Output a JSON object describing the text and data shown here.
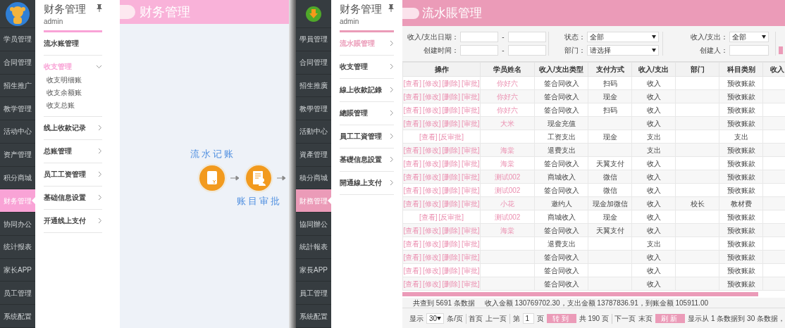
{
  "left_screen": {
    "sidebar": {
      "items": [
        {
          "label": "学员管理",
          "selected": false
        },
        {
          "label": "合同管理",
          "selected": false
        },
        {
          "label": "招生推广",
          "selected": false
        },
        {
          "label": "教学管理",
          "selected": false
        },
        {
          "label": "活动中心",
          "selected": false
        },
        {
          "label": "资产管理",
          "selected": false
        },
        {
          "label": "积分商城",
          "selected": false
        },
        {
          "label": "财务管理",
          "selected": true
        },
        {
          "label": "协同办公",
          "selected": false
        },
        {
          "label": "统计报表",
          "selected": false
        },
        {
          "label": "家长APP",
          "selected": false
        },
        {
          "label": "员工管理",
          "selected": false
        },
        {
          "label": "系统配置",
          "selected": false
        }
      ]
    },
    "menu": {
      "title": "财务管理",
      "user": "admin",
      "items": [
        {
          "label": "流水账管理",
          "kind": "link",
          "selected": false
        },
        {
          "label": "收支管理",
          "kind": "group",
          "selected": true,
          "expanded": true,
          "children": [
            {
              "label": "收支明细账"
            },
            {
              "label": "收支余额账"
            },
            {
              "label": "收支总账"
            }
          ]
        },
        {
          "label": "线上收款记录",
          "kind": "group",
          "selected": false,
          "expanded": false
        },
        {
          "label": "总账管理",
          "kind": "group",
          "selected": false,
          "expanded": false
        },
        {
          "label": "员工工资管理",
          "kind": "group",
          "selected": false,
          "expanded": false
        },
        {
          "label": "基础信息设置",
          "kind": "group",
          "selected": false,
          "expanded": false
        },
        {
          "label": "开通线上支付",
          "kind": "group",
          "selected": false,
          "expanded": false
        }
      ]
    },
    "page_header": {
      "title": "财务管理"
    },
    "flow": {
      "top_labels": [
        "流水记账"
      ],
      "bottom_labels": [
        "账目审批"
      ]
    }
  },
  "right_screen": {
    "sidebar": {
      "items": [
        {
          "label": "學員管理",
          "selected": false
        },
        {
          "label": "合同管理",
          "selected": false
        },
        {
          "label": "招生推廣",
          "selected": false
        },
        {
          "label": "教學管理",
          "selected": false
        },
        {
          "label": "活動中心",
          "selected": false
        },
        {
          "label": "資產管理",
          "selected": false
        },
        {
          "label": "積分商城",
          "selected": false
        },
        {
          "label": "財務管理",
          "selected": true
        },
        {
          "label": "協同辦公",
          "selected": false
        },
        {
          "label": "統計報表",
          "selected": false
        },
        {
          "label": "家長APP",
          "selected": false
        },
        {
          "label": "員工管理",
          "selected": false
        },
        {
          "label": "系統配置",
          "selected": false
        }
      ]
    },
    "menu": {
      "title": "财务管理",
      "user": "admin",
      "items": [
        {
          "label": "流水賬管理",
          "kind": "group",
          "selected": true,
          "expanded": false
        },
        {
          "label": "收支管理",
          "kind": "group",
          "selected": false,
          "expanded": false
        },
        {
          "label": "線上收款記錄",
          "kind": "group",
          "selected": false,
          "expanded": false
        },
        {
          "label": "總賬管理",
          "kind": "group",
          "selected": false,
          "expanded": false
        },
        {
          "label": "員工工資管理",
          "kind": "group",
          "selected": false,
          "expanded": false
        },
        {
          "label": "基礎信息設置",
          "kind": "group",
          "selected": false,
          "expanded": false
        },
        {
          "label": "開通線上支付",
          "kind": "group",
          "selected": false,
          "expanded": false
        }
      ]
    },
    "page_header": {
      "title": "流水賬管理"
    },
    "filters": {
      "date_label": "收入/支出日期：",
      "created_label": "创建时间：",
      "range_separators": [
        "-",
        "-"
      ],
      "status_label": "状态：",
      "status_value": "全部",
      "department_label": "部门：",
      "department_value": "请选择",
      "direction_label": "收入/支出：",
      "direction_value": "全部",
      "creator_label": "创建人："
    },
    "table": {
      "columns": [
        "操作",
        "学员姓名",
        "收入/支出类型",
        "支付方式",
        "收入/支出",
        "部门",
        "科目类别",
        "收入"
      ],
      "rows": [
        {
          "actions": [
            "[查看]",
            "[修改]",
            "[删除]",
            "[审批]"
          ],
          "student": "你好六",
          "type": "签合同收入",
          "payment": "扫码",
          "direction": "收入",
          "category": "预收账款"
        },
        {
          "actions": [
            "[查看]",
            "[修改]",
            "[删除]",
            "[审批]"
          ],
          "student": "你好六",
          "type": "签合同收入",
          "payment": "现金",
          "direction": "收入",
          "category": "预收账款"
        },
        {
          "actions": [
            "[查看]",
            "[修改]",
            "[删除]",
            "[审批]"
          ],
          "student": "你好六",
          "type": "签合同收入",
          "payment": "扫码",
          "direction": "收入",
          "category": "预收账款"
        },
        {
          "actions": [
            "[查看]",
            "[修改]",
            "[删除]",
            "[审批]"
          ],
          "student": "大米",
          "type": "现金充值",
          "direction": "收入",
          "category": "预收账款"
        },
        {
          "actions": [
            "[查看]",
            "[反审批]"
          ],
          "type": "工资支出",
          "payment": "现金",
          "direction": "支出",
          "category": "支出"
        },
        {
          "actions": [
            "[查看]",
            "[修改]",
            "[删除]",
            "[审批]"
          ],
          "student": "海棠",
          "type": "退费支出",
          "direction": "支出",
          "category": "预收账款"
        },
        {
          "actions": [
            "[查看]",
            "[修改]",
            "[删除]",
            "[审批]"
          ],
          "student": "海棠",
          "type": "签合同收入",
          "payment": "天翼支付",
          "direction": "收入",
          "category": "预收账款"
        },
        {
          "actions": [
            "[查看]",
            "[修改]",
            "[删除]",
            "[审批]"
          ],
          "student": "测试002",
          "type": "商城收入",
          "payment": "微信",
          "direction": "收入",
          "category": "预收账款"
        },
        {
          "actions": [
            "[查看]",
            "[修改]",
            "[删除]",
            "[审批]"
          ],
          "student": "测试002",
          "type": "签合同收入",
          "payment": "微信",
          "direction": "收入",
          "category": "预收账款"
        },
        {
          "actions": [
            "[查看]",
            "[修改]",
            "[删除]",
            "[审批]"
          ],
          "student": "小花",
          "type": "邀约人",
          "payment": "现金加微信",
          "direction": "收入",
          "department": "校长",
          "category": "教材费"
        },
        {
          "actions": [
            "[查看]",
            "[反审批]"
          ],
          "student": "测试002",
          "type": "商城收入",
          "payment": "现金",
          "direction": "收入",
          "category": "预收账款"
        },
        {
          "actions": [
            "[查看]",
            "[修改]",
            "[删除]",
            "[审批]"
          ],
          "student": "海棠",
          "type": "签合同收入",
          "payment": "天翼支付",
          "direction": "收入",
          "category": "预收账款"
        },
        {
          "actions": [
            "[查看]",
            "[修改]",
            "[删除]",
            "[审批]"
          ],
          "type": "退费支出",
          "direction": "支出",
          "category": "预收账款"
        },
        {
          "actions": [
            "[查看]",
            "[修改]",
            "[删除]",
            "[审批]"
          ],
          "type": "签合同收入",
          "direction": "收入",
          "category": "预收账款"
        },
        {
          "actions": [
            "[查看]",
            "[修改]",
            "[删除]",
            "[审批]"
          ],
          "type": "签合同收入",
          "direction": "收入",
          "category": "预收账款"
        },
        {
          "actions": [
            "[查看]",
            "[修改]",
            "[删除]",
            "[审批]"
          ],
          "type": "签合同收入",
          "direction": "收入",
          "category": "预收账款"
        }
      ]
    },
    "summary": {
      "count": "共查到 5691 条数据",
      "totals": "收入金额 130769702.30，支出金额 13787836.91，到账金额 105911.00"
    },
    "pagination": {
      "show_label": "显示",
      "page_size": "30",
      "per_page_label": "条/页",
      "first": "首页",
      "prev": "上一页",
      "page_prefix": "第",
      "page_value": "1",
      "page_suffix": "页",
      "go": "转到",
      "total_pages": "共 190 页",
      "next": "下一页",
      "last": "末页",
      "refresh": "刷新",
      "range_text": "显示从 1 条数据到 30 条数据，"
    }
  }
}
